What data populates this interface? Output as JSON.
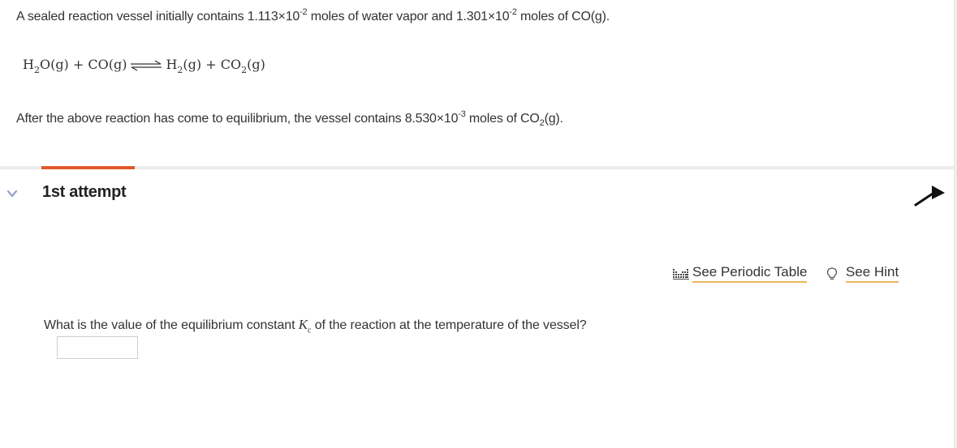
{
  "problem": {
    "intro_before1": "A sealed reaction vessel initially contains 1.113×10",
    "intro_exp1": "-2",
    "intro_mid": " moles of water vapor and 1.301×10",
    "intro_exp2": "-2",
    "intro_after": " moles of CO(g).",
    "equation": {
      "r1_main": "H",
      "r1_sub": "2",
      "r1_rest": "O(g)",
      "plus1": " + ",
      "r2": "CO(g)",
      "p1_main": "H",
      "p1_sub": "2",
      "p1_rest": "(g)",
      "plus2": " + ",
      "p2_main": "CO",
      "p2_sub": "2",
      "p2_rest": "(g)"
    },
    "after_before": "After the above reaction has come to equilibrium, the vessel contains 8.530×10",
    "after_exp": "-3",
    "after_mid": " moles of CO",
    "after_sub": "2",
    "after_end": "(g)."
  },
  "attempt": {
    "title": "1st attempt"
  },
  "tools": {
    "periodic_label": "See Periodic Table",
    "hint_label": "See Hint"
  },
  "question": {
    "text_before": "What is the value of the equilibrium constant ",
    "kc_main": "K",
    "kc_sub": "c",
    "text_after": " of the reaction at the temperature of the vessel?",
    "answer_value": "",
    "answer_placeholder": ""
  },
  "colors": {
    "accent_tab": "#e05a2b",
    "link_underline": "#e8b85a",
    "divider": "#ececec"
  }
}
